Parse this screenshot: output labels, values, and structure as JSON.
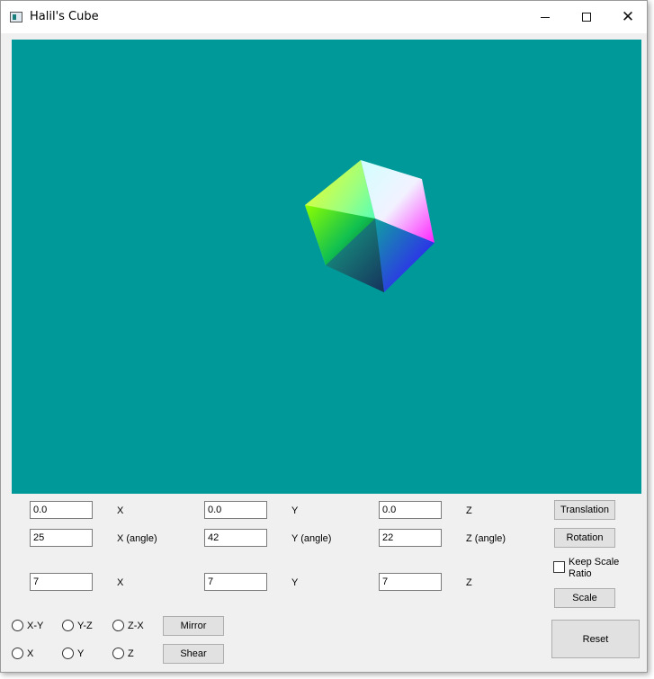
{
  "window": {
    "title": "Halil's Cube"
  },
  "translation": {
    "x_value": "0.0",
    "x_label": "X",
    "y_value": "0.0",
    "y_label": "Y",
    "z_value": "0.0",
    "z_label": "Z",
    "button": "Translation"
  },
  "rotation": {
    "x_value": "25",
    "x_label": "X (angle)",
    "y_value": "42",
    "y_label": "Y (angle)",
    "z_value": "22",
    "z_label": "Z (angle)",
    "button": "Rotation"
  },
  "scale": {
    "x_value": "7",
    "x_label": "X",
    "y_value": "7",
    "y_label": "Y",
    "z_value": "7",
    "z_label": "Z",
    "button": "Scale",
    "keep_ratio_label_1": "Keep Scale",
    "keep_ratio_label_2": "Ratio"
  },
  "mirror": {
    "options": [
      "X-Y",
      "Y-Z",
      "Z-X"
    ],
    "button": "Mirror"
  },
  "shear": {
    "options": [
      "X",
      "Y",
      "Z"
    ],
    "button": "Shear"
  },
  "reset_button": "Reset",
  "colors": {
    "viewport_bg": "#009999"
  }
}
